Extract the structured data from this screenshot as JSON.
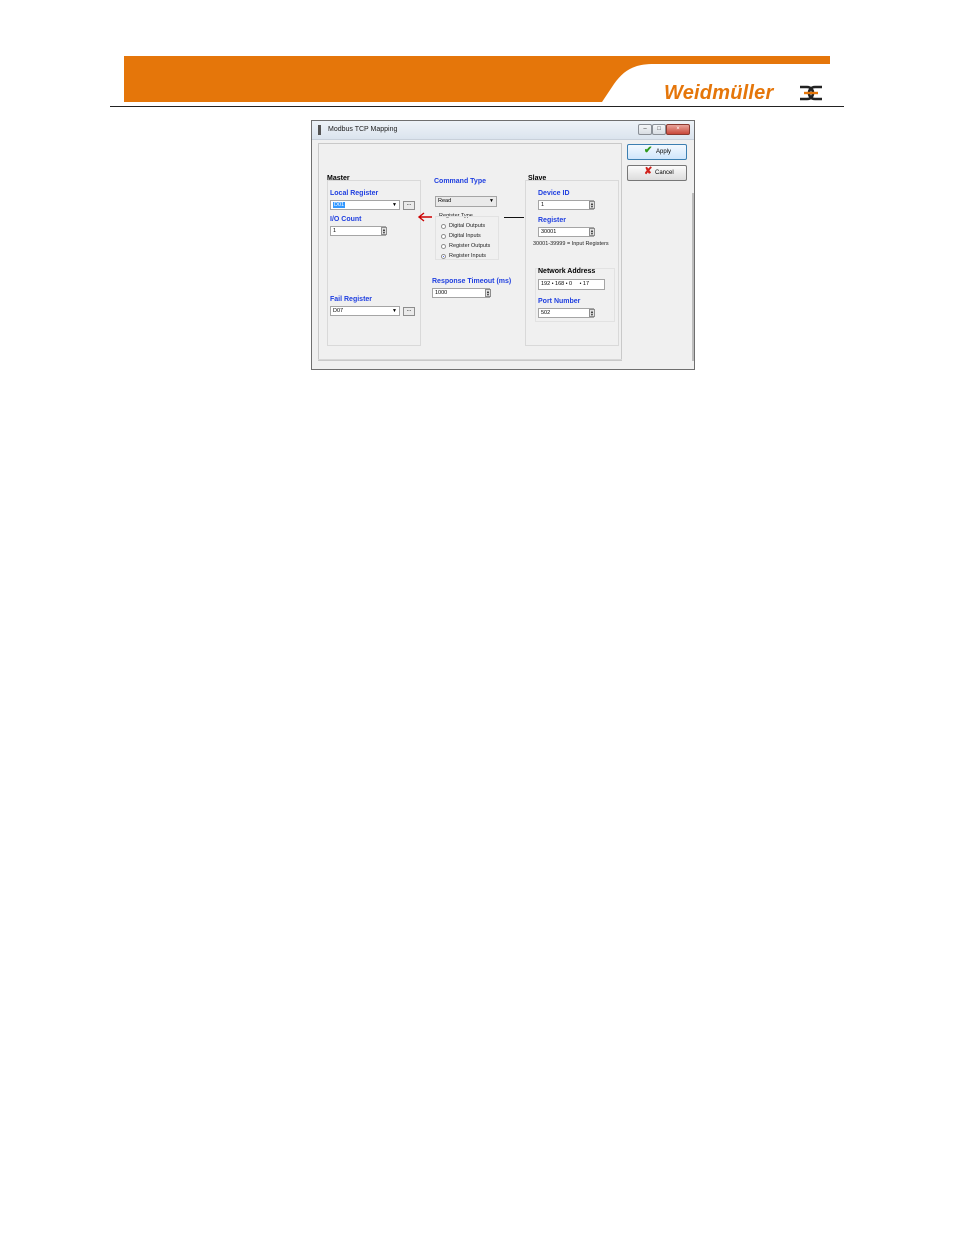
{
  "header": {
    "brand": "Weidmüller",
    "bar_color": "#e5760a"
  },
  "window": {
    "title": "Modbus TCP Mapping",
    "controls": {
      "minimize": "–",
      "maximize": "□",
      "close": "×"
    }
  },
  "master": {
    "heading": "Master",
    "local_register_label": "Local Register",
    "local_register_value": "D01",
    "io_count_label": "I/O Count",
    "io_count_value": "1",
    "fail_register_label": "Fail Register",
    "fail_register_value": "D07",
    "browse_label": "..."
  },
  "command": {
    "heading": "Command Type",
    "command_value": "Read",
    "register_type_label": "Register Type",
    "register_types": [
      "Digital Outputs",
      "Digital Inputs",
      "Register Outputs",
      "Register Inputs"
    ],
    "selected_register_type": "Register Inputs",
    "timeout_label": "Response Timeout (ms)",
    "timeout_value": "1000"
  },
  "slave": {
    "heading": "Slave",
    "device_id_label": "Device ID",
    "device_id_value": "1",
    "register_label": "Register",
    "register_value": "30001",
    "register_hint": "30001-39999 = Input Registers",
    "network_address_label": "Network Address",
    "ip": [
      "192",
      "168",
      "0",
      "17"
    ],
    "port_label": "Port Number",
    "port_value": "502"
  },
  "actions": {
    "apply_label": "Apply",
    "cancel_label": "Cancel"
  },
  "colors": {
    "label_blue": "#1f3fe0",
    "arrow_red": "#cc0000"
  }
}
